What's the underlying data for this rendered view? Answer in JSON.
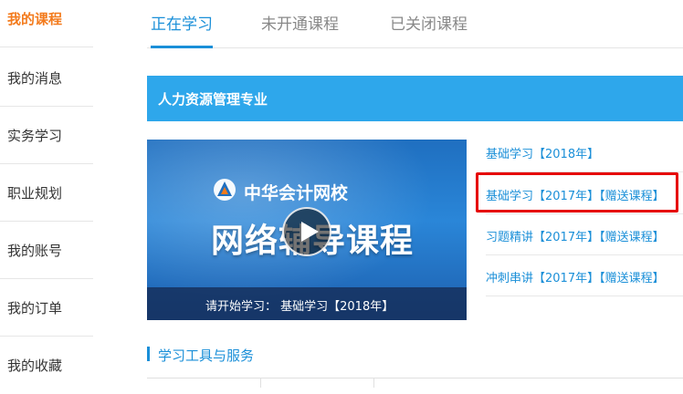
{
  "sidebar": {
    "items": [
      {
        "label": "我的课程",
        "active": true
      },
      {
        "label": "我的消息"
      },
      {
        "label": "实务学习"
      },
      {
        "label": "职业规划"
      },
      {
        "label": "我的账号"
      },
      {
        "label": "我的订单"
      },
      {
        "label": "我的收藏"
      }
    ]
  },
  "tabs": [
    {
      "label": "正在学习",
      "active": true
    },
    {
      "label": "未开通课程"
    },
    {
      "label": "已关闭课程"
    }
  ],
  "major": {
    "title": "人力资源管理专业"
  },
  "video": {
    "logo_text": "中华会计网校",
    "banner_title": "网络辅导课程",
    "play_icon": "play-icon",
    "caption": "请开始学习： 基础学习【2018年】"
  },
  "courses": [
    {
      "label": "基础学习【2018年】"
    },
    {
      "label": "基础学习【2017年】【赠送课程】",
      "highlighted": true
    },
    {
      "label": "习题精讲【2017年】【赠送课程】"
    },
    {
      "label": "冲刺串讲【2017年】【赠送课程】"
    }
  ],
  "tools": {
    "title": "学习工具与服务"
  },
  "colors": {
    "accent": "#1a8fd8",
    "sidebar_active": "#f37b1d",
    "header_bg": "#2ea7eb",
    "highlight_border": "#e60000"
  }
}
